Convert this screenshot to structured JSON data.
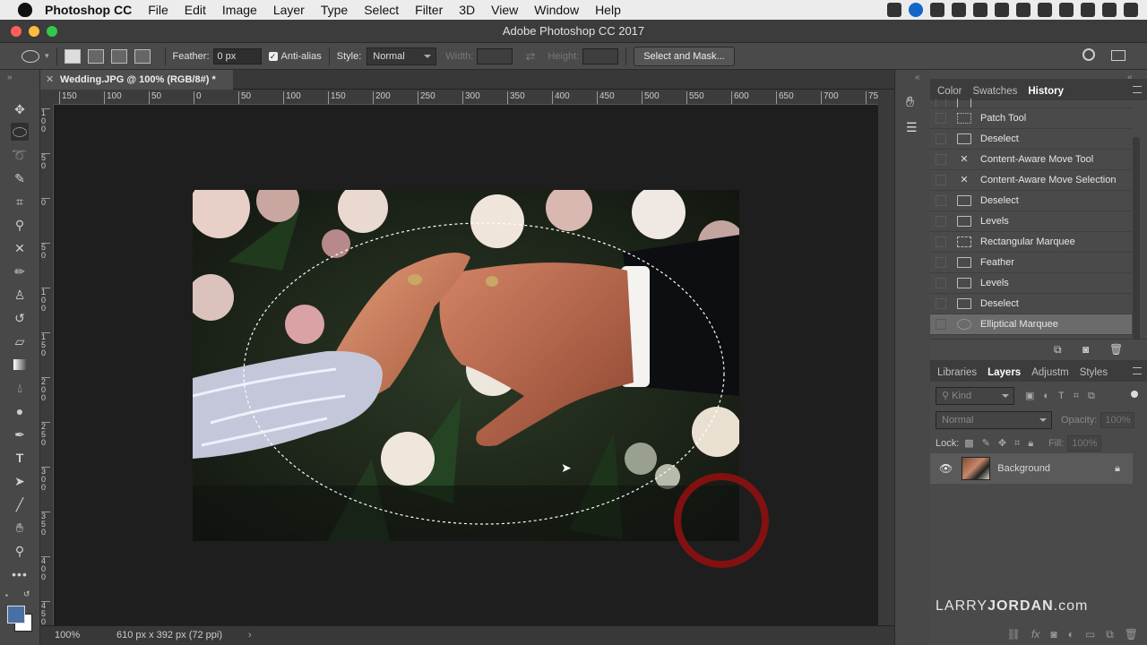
{
  "menubar": {
    "app_name": "Photoshop CC",
    "items": [
      "File",
      "Edit",
      "Image",
      "Layer",
      "Type",
      "Select",
      "Filter",
      "3D",
      "View",
      "Window",
      "Help"
    ]
  },
  "window": {
    "title": "Adobe Photoshop CC 2017"
  },
  "options": {
    "feather_label": "Feather:",
    "feather_value": "0 px",
    "antialias_label": "Anti-alias",
    "antialias_checked": true,
    "style_label": "Style:",
    "style_value": "Normal",
    "width_label": "Width:",
    "height_label": "Height:",
    "select_mask_label": "Select and Mask..."
  },
  "document": {
    "tab_title": "Wedding.JPG @ 100% (RGB/8#) *",
    "zoom": "100%",
    "info": "610 px x 392 px (72 ppi)"
  },
  "ruler": {
    "h_labels": [
      "150",
      "100",
      "50",
      "0",
      "50",
      "100",
      "150",
      "200",
      "250",
      "300",
      "350",
      "400",
      "450",
      "500",
      "550",
      "600",
      "650",
      "700",
      "75"
    ],
    "v_labels": [
      "1 0 0",
      "5 0",
      "0",
      "5 0",
      "1 0 0",
      "1 5 0",
      "2 0 0",
      "2 5 0",
      "3 0 0",
      "3 5 0",
      "4 0 0",
      "4 5 0"
    ]
  },
  "history_panel": {
    "tabs": [
      "Color",
      "Swatches",
      "History"
    ],
    "active_tab": "History",
    "items": [
      {
        "label": "Patch Tool",
        "icon": "patch-icon"
      },
      {
        "label": "Deselect",
        "icon": "document-icon"
      },
      {
        "label": "Content-Aware Move Tool",
        "icon": "content-aware-move-icon"
      },
      {
        "label": "Content-Aware Move Selection",
        "icon": "content-aware-move-icon"
      },
      {
        "label": "Deselect",
        "icon": "document-icon"
      },
      {
        "label": "Levels",
        "icon": "document-icon"
      },
      {
        "label": "Rectangular Marquee",
        "icon": "rect-marquee-icon"
      },
      {
        "label": "Feather",
        "icon": "document-icon"
      },
      {
        "label": "Levels",
        "icon": "document-icon"
      },
      {
        "label": "Deselect",
        "icon": "document-icon"
      },
      {
        "label": "Elliptical Marquee",
        "icon": "ellipse-marquee-icon"
      }
    ]
  },
  "layers_panel": {
    "tabs": [
      "Libraries",
      "Layers",
      "Adjustm",
      "Styles"
    ],
    "active_tab": "Layers",
    "kind_placeholder": "Kind",
    "blend_mode": "Normal",
    "opacity_label": "Opacity:",
    "opacity_value": "100%",
    "lock_label": "Lock:",
    "fill_label": "Fill:",
    "fill_value": "100%",
    "layers": [
      {
        "name": "Background",
        "visible": true,
        "locked": true
      }
    ]
  },
  "watermark": {
    "prefix": "LARRY",
    "bold": "JORDAN",
    "suffix": ".com"
  },
  "colors": {
    "accent_red": "#8b1010",
    "foreground": "#4a6fa5",
    "background": "#ffffff"
  }
}
